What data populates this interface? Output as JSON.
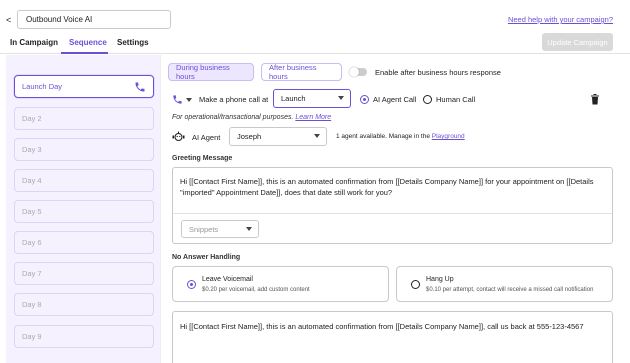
{
  "header": {
    "back_label": "<",
    "campaign_name": "Outbound Voice AI",
    "help_link": "Need help with your campaign?",
    "update_button": "Update Campaign"
  },
  "tabs": [
    {
      "label": "In Campaign"
    },
    {
      "label": "Sequence"
    },
    {
      "label": "Settings"
    }
  ],
  "sidebar": {
    "days": [
      {
        "label": "Launch Day"
      },
      {
        "label": "Day 2"
      },
      {
        "label": "Day 3"
      },
      {
        "label": "Day 4"
      },
      {
        "label": "Day 5"
      },
      {
        "label": "Day 6"
      },
      {
        "label": "Day 7"
      },
      {
        "label": "Day 8"
      },
      {
        "label": "Day 9"
      }
    ]
  },
  "hours": {
    "during": "During business hours",
    "after": "After business hours",
    "toggle_label": "Enable after business hours response"
  },
  "action": {
    "make_call": "Make a phone call",
    "at": "at",
    "when_value": "Launch",
    "ai_call": "AI Agent Call",
    "human_call": "Human Call",
    "note": "For operational/transactional purposes.",
    "learn_more": "Learn More"
  },
  "agent": {
    "label": "AI Agent",
    "value": "Joseph",
    "info": "1 agent available. Manage in the",
    "playground": "Playground"
  },
  "greeting": {
    "title": "Greeting Message",
    "text": "Hi [[Contact First Name]], this is an automated confirmation from [[Details Company Name]] for your appointment on [[Details \"imported\" Appointment Date]], does that date still work for you?",
    "snippets": "Snippets"
  },
  "no_answer": {
    "title": "No Answer Handling",
    "voicemail_title": "Leave Voicemail",
    "voicemail_sub": "$0.20 per voicemail, add custom content",
    "hangup_title": "Hang Up",
    "hangup_sub": "$0.10 per attempt, contact will receive a missed call notification",
    "voicemail_text": "Hi [[Contact First Name]], this is an automated confirmation from [[Details Company Name]], call us back at 555-123-4567"
  },
  "colors": {
    "accent": "#6d4fd6",
    "sidebar_bg": "#f5f1ff"
  }
}
